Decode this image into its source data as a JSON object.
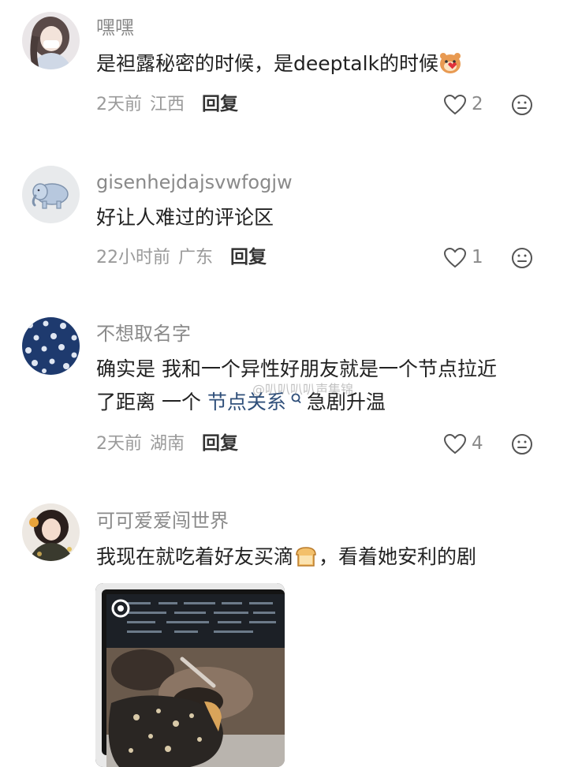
{
  "comments": [
    {
      "username": "嘿嘿",
      "content": "是袒露秘密的时候，是deeptalk的时候",
      "emoji": "hamster-heart-emoji",
      "time": "2天前",
      "location": "江西",
      "reply": "回复",
      "likes": "2"
    },
    {
      "username": "gisenhejdajsvwfogjw",
      "content": "好让人难过的评论区",
      "time": "22小时前",
      "location": "广东",
      "reply": "回复",
      "likes": "1"
    },
    {
      "username": "不想取名字",
      "content_line1": "确实是 我和一个异性好朋友就是一个节点拉近",
      "content_line2_pre": "了距离 一个 ",
      "content_link": "节点关系",
      "content_line2_post": "急剧升温",
      "time": "2天前",
      "location": "湖南",
      "reply": "回复",
      "likes": "4"
    },
    {
      "username": "可可爱爱闯世界",
      "content_pre": "我现在就吃着好友买滴",
      "emoji": "bread-emoji",
      "content_post": "，看着她安利的剧"
    }
  ],
  "watermark": "@叭叭叭叭声集锦",
  "colors": {
    "username": "#8a8a8a",
    "content": "#222222",
    "meta": "#9a9a9a",
    "link": "#2f4f7a"
  }
}
